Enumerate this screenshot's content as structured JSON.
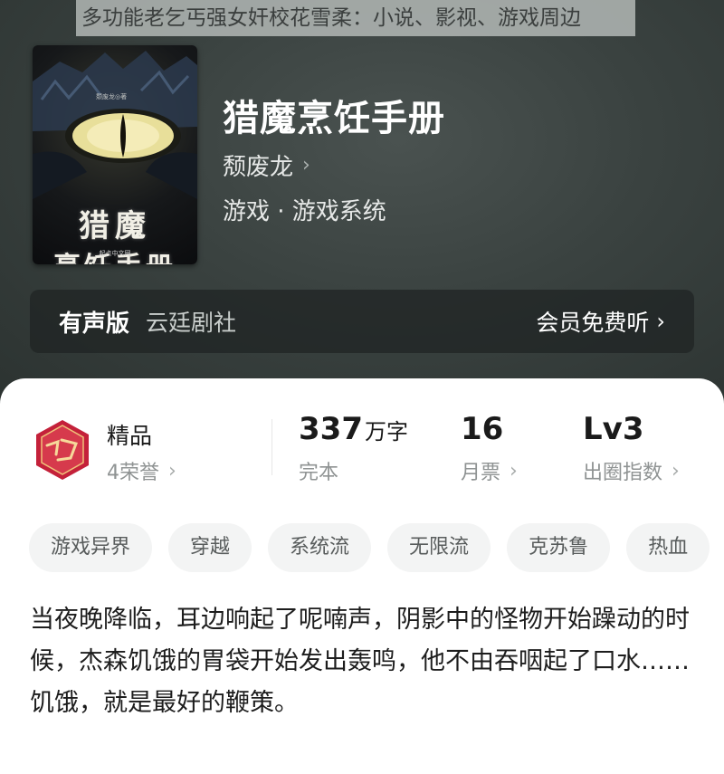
{
  "banner": {
    "text": "多功能老乞丐强女奸校花雪柔：小说、影视、游戏周边"
  },
  "cover": {
    "author_small": "颓废龙◎著",
    "title_line1": "猎魔",
    "title_line2": "烹饪手册",
    "publisher": "起点中文网"
  },
  "book": {
    "title": "猎魔烹饪手册",
    "author": "颓废龙",
    "category": "游戏 · 游戏系统"
  },
  "audio": {
    "label": "有声版",
    "studio": "云廷剧社",
    "action": "会员免费听"
  },
  "stats": {
    "grade": {
      "title": "精品",
      "sub": "4荣誉"
    },
    "words": {
      "value": "337",
      "unit": "万字",
      "sub": "完本"
    },
    "tickets": {
      "value": "16",
      "sub": "月票"
    },
    "level": {
      "value": "Lv3",
      "sub": "出圈指数"
    }
  },
  "tags": [
    "游戏异界",
    "穿越",
    "系统流",
    "无限流",
    "克苏鲁",
    "热血"
  ],
  "synopsis": {
    "para1": "当夜晚降临，耳边响起了呢喃声，阴影中的怪物开始躁动的时候，杰森饥饿的胃袋开始发出轰鸣，他不由吞咽起了口水……",
    "para2": "饥饿，就是最好的鞭策。"
  },
  "colors": {
    "hero_bg": "#3a4240",
    "card_bg": "#ffffff",
    "badge_red": "#c4213a",
    "tag_bg": "#f3f4f4"
  }
}
